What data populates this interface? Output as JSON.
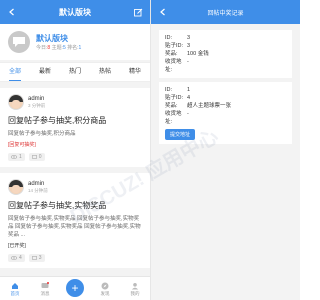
{
  "left": {
    "nav_title": "默认版块",
    "forum": {
      "name": "默认版块",
      "stats_today_label": "今日:",
      "stats_today": "8",
      "stats_topics_label": "主题:",
      "stats_topics": "5",
      "stats_rank_label": "排名:",
      "stats_rank": "1"
    },
    "tabs": [
      {
        "label": "全部"
      },
      {
        "label": "最新"
      },
      {
        "label": "热门"
      },
      {
        "label": "热帖"
      },
      {
        "label": "精华"
      }
    ],
    "posts": [
      {
        "author": "admin",
        "time": "3 分钟前",
        "title": "回复帖子参与抽奖,积分商品",
        "body": "回复帖子参与抽奖,积分商品",
        "tag": "[回复可抽奖]",
        "views": "1",
        "replies": "0"
      },
      {
        "author": "admin",
        "time": "14 分钟前",
        "title": "回复帖子参与抽奖,实物奖品",
        "body": "回复帖子参与抽奖,实物奖品 回复帖子参与抽奖,实物奖品 回复帖子参与抽奖,实物奖品 回复帖子参与抽奖,实物奖品 ...",
        "tag": "[已开奖]",
        "views": "4",
        "replies": "3"
      }
    ],
    "tabbar": [
      {
        "label": "首页"
      },
      {
        "label": "消息"
      },
      {
        "label": ""
      },
      {
        "label": "发现"
      },
      {
        "label": "我的"
      }
    ]
  },
  "right": {
    "nav_title": "回帖中奖记录",
    "records": [
      {
        "id_label": "ID:",
        "id": "3",
        "floor_label": "贴子ID:",
        "floor": "3",
        "prize_label": "奖品:",
        "prize": "100 金钱",
        "addr_label": "收货地址:",
        "addr": "-"
      },
      {
        "id_label": "ID:",
        "id": "1",
        "floor_label": "贴子ID:",
        "floor": "4",
        "prize_label": "奖品:",
        "prize": "超人主题球票一张",
        "addr_label": "收货地址:",
        "addr": "-",
        "button": "提交地址"
      }
    ]
  },
  "watermark": "DISCUZ! 应用中心",
  "colors": {
    "accent": "#3f8ee8",
    "alert": "#e33333"
  }
}
